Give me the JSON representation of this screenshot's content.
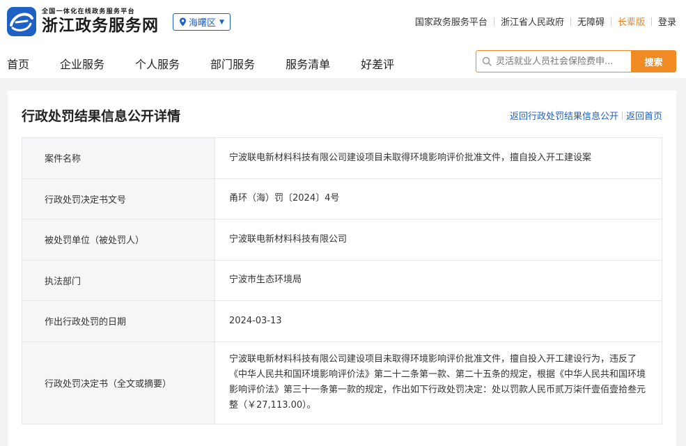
{
  "header": {
    "logo_sub": "全国一体化在线政务服务平台",
    "logo_main": "浙江政务服务网",
    "region": "海曙区",
    "top_links": [
      "国家政务服务平台",
      "浙江省人民政府",
      "无障碍",
      "长辈版",
      "登录"
    ],
    "nav": [
      "首页",
      "企业服务",
      "个人服务",
      "部门服务",
      "服务清单",
      "好差评"
    ],
    "search_placeholder": "灵活就业人员社会保险费申...",
    "search_button": "搜索"
  },
  "colors": {
    "brand": "#1f60c4",
    "accent": "#f08b23"
  },
  "page": {
    "title": "行政处罚结果信息公开详情",
    "links": [
      "返回行政处罚结果信息公开",
      "返回首页"
    ]
  },
  "details": [
    {
      "label": "案件名称",
      "value": "宁波联电新材料科技有限公司建设项目未取得环境影响评价批准文件，擅自投入开工建设案"
    },
    {
      "label": "行政处罚决定书文号",
      "value": "甬环（海）罚〔2024〕4号"
    },
    {
      "label": "被处罚单位（被处罚人）",
      "value": "宁波联电新材料科技有限公司"
    },
    {
      "label": "执法部门",
      "value": "宁波市生态环境局"
    },
    {
      "label": "作出行政处罚的日期",
      "value": "2024-03-13"
    },
    {
      "label": "行政处罚决定书（全文或摘要）",
      "value": "宁波联电新材料科技有限公司建设项目未取得环境影响评价批准文件，擅自投入开工建设行为，违反了《中华人民共和国环境影响评价法》第二十二条第一款、第二十五条的规定，根据《中华人民共和国环境影响评价法》第三十一条第一款的规定，作出如下行政处罚决定：处以罚款人民币贰万柒仟壹佰壹拾叁元整（￥27,113.00）。"
    }
  ]
}
